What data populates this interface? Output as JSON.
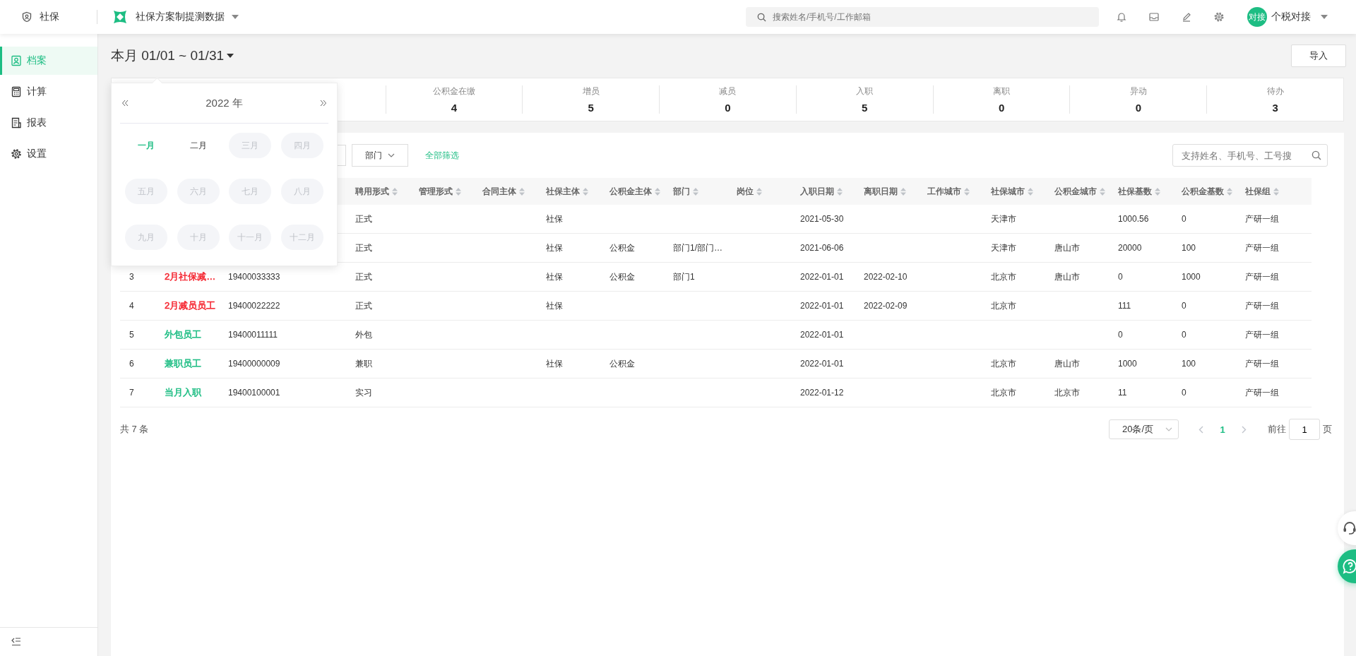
{
  "topbar": {
    "app_name": "社保",
    "project": "社保方案制提测数据",
    "search": {
      "placeholder": "搜索姓名/手机号/工作邮箱"
    },
    "user": {
      "avatar": "对接",
      "name": "个税对接"
    }
  },
  "sidebar": {
    "items": [
      {
        "label": "档案",
        "selected": true
      },
      {
        "label": "计算",
        "selected": false
      },
      {
        "label": "报表",
        "selected": false
      },
      {
        "label": "设置",
        "selected": false
      }
    ]
  },
  "period": "本月 01/01 ~ 01/31",
  "import_button": "导入",
  "stats": [
    {
      "label": "公积金在缴",
      "value": "4"
    },
    {
      "label": "增员",
      "value": "5"
    },
    {
      "label": "减员",
      "value": "0"
    },
    {
      "label": "入职",
      "value": "5"
    },
    {
      "label": "离职",
      "value": "0"
    },
    {
      "label": "异动",
      "value": "0"
    },
    {
      "label": "待办",
      "value": "3"
    }
  ],
  "filters": {
    "department": "部门",
    "all_filters": "全部筛选",
    "search": {
      "placeholder": "支持姓名、手机号、工号搜"
    }
  },
  "table": {
    "columns": [
      "聘用形式",
      "管理形式",
      "合同主体",
      "社保主体",
      "公积金主体",
      "部门",
      "岗位",
      "入职日期",
      "离职日期",
      "工作城市",
      "社保城市",
      "公积金城市",
      "社保基数",
      "公积金基数",
      "社保组"
    ],
    "rows": [
      {
        "cells": [
          "正式",
          null,
          null,
          "社保",
          null,
          null,
          null,
          "2021-05-30",
          null,
          null,
          "天津市",
          null,
          "1000.56",
          "0",
          "产研一组"
        ]
      },
      {
        "cells": [
          "正式",
          null,
          null,
          "社保",
          "公积金",
          "部门1/部门…",
          null,
          "2021-06-06",
          null,
          null,
          "天津市",
          "唐山市",
          "20000",
          "100",
          "产研一组"
        ]
      },
      {
        "index": "3",
        "name": "2月社保减…",
        "color": "#f5222d",
        "phone": "19400033333",
        "cells": [
          "正式",
          null,
          null,
          "社保",
          "公积金",
          "部门1",
          null,
          "2022-01-01",
          "2022-02-10",
          null,
          "北京市",
          "唐山市",
          "0",
          "1000",
          "产研一组"
        ]
      },
      {
        "index": "4",
        "name": "2月减员员工",
        "color": "#f5222d",
        "phone": "19400022222",
        "cells": [
          "正式",
          null,
          null,
          "社保",
          null,
          null,
          null,
          "2022-01-01",
          "2022-02-09",
          null,
          "北京市",
          null,
          "111",
          "0",
          "产研一组"
        ]
      },
      {
        "index": "5",
        "name": "外包员工",
        "color": "#1dbd83",
        "phone": "19400011111",
        "cells": [
          "外包",
          null,
          null,
          null,
          null,
          null,
          null,
          "2022-01-01",
          null,
          null,
          null,
          null,
          "0",
          "0",
          "产研一组"
        ]
      },
      {
        "index": "6",
        "name": "兼职员工",
        "color": "#1dbd83",
        "phone": "19400000009",
        "cells": [
          "兼职",
          null,
          null,
          "社保",
          "公积金",
          null,
          null,
          "2022-01-01",
          null,
          null,
          "北京市",
          "唐山市",
          "1000",
          "100",
          "产研一组"
        ]
      },
      {
        "index": "7",
        "name": "当月入职",
        "color": "#1dbd83",
        "phone": "19400100001",
        "cells": [
          "实习",
          null,
          null,
          null,
          null,
          null,
          null,
          "2022-01-12",
          null,
          null,
          "北京市",
          "北京市",
          "11",
          "0",
          "产研一组"
        ]
      }
    ]
  },
  "pagination": {
    "total": "共 7 条",
    "page_size": "20条/页",
    "pages": [
      {
        "label": "1",
        "selected": true
      }
    ],
    "goto_label": "前往",
    "goto_value": "1",
    "page_suffix": "页"
  },
  "month_picker": {
    "year": "2022 年",
    "months": [
      {
        "label": "一月",
        "selected": true,
        "disabled": false
      },
      {
        "label": "二月",
        "selected": false,
        "disabled": false
      },
      {
        "label": "三月",
        "selected": false,
        "disabled": true
      },
      {
        "label": "四月",
        "selected": false,
        "disabled": true
      },
      {
        "label": "五月",
        "selected": false,
        "disabled": true
      },
      {
        "label": "六月",
        "selected": false,
        "disabled": true
      },
      {
        "label": "七月",
        "selected": false,
        "disabled": true
      },
      {
        "label": "八月",
        "selected": false,
        "disabled": true
      },
      {
        "label": "九月",
        "selected": false,
        "disabled": true
      },
      {
        "label": "十月",
        "selected": false,
        "disabled": true
      },
      {
        "label": "十一月",
        "selected": false,
        "disabled": true
      },
      {
        "label": "十二月",
        "selected": false,
        "disabled": true
      }
    ]
  }
}
